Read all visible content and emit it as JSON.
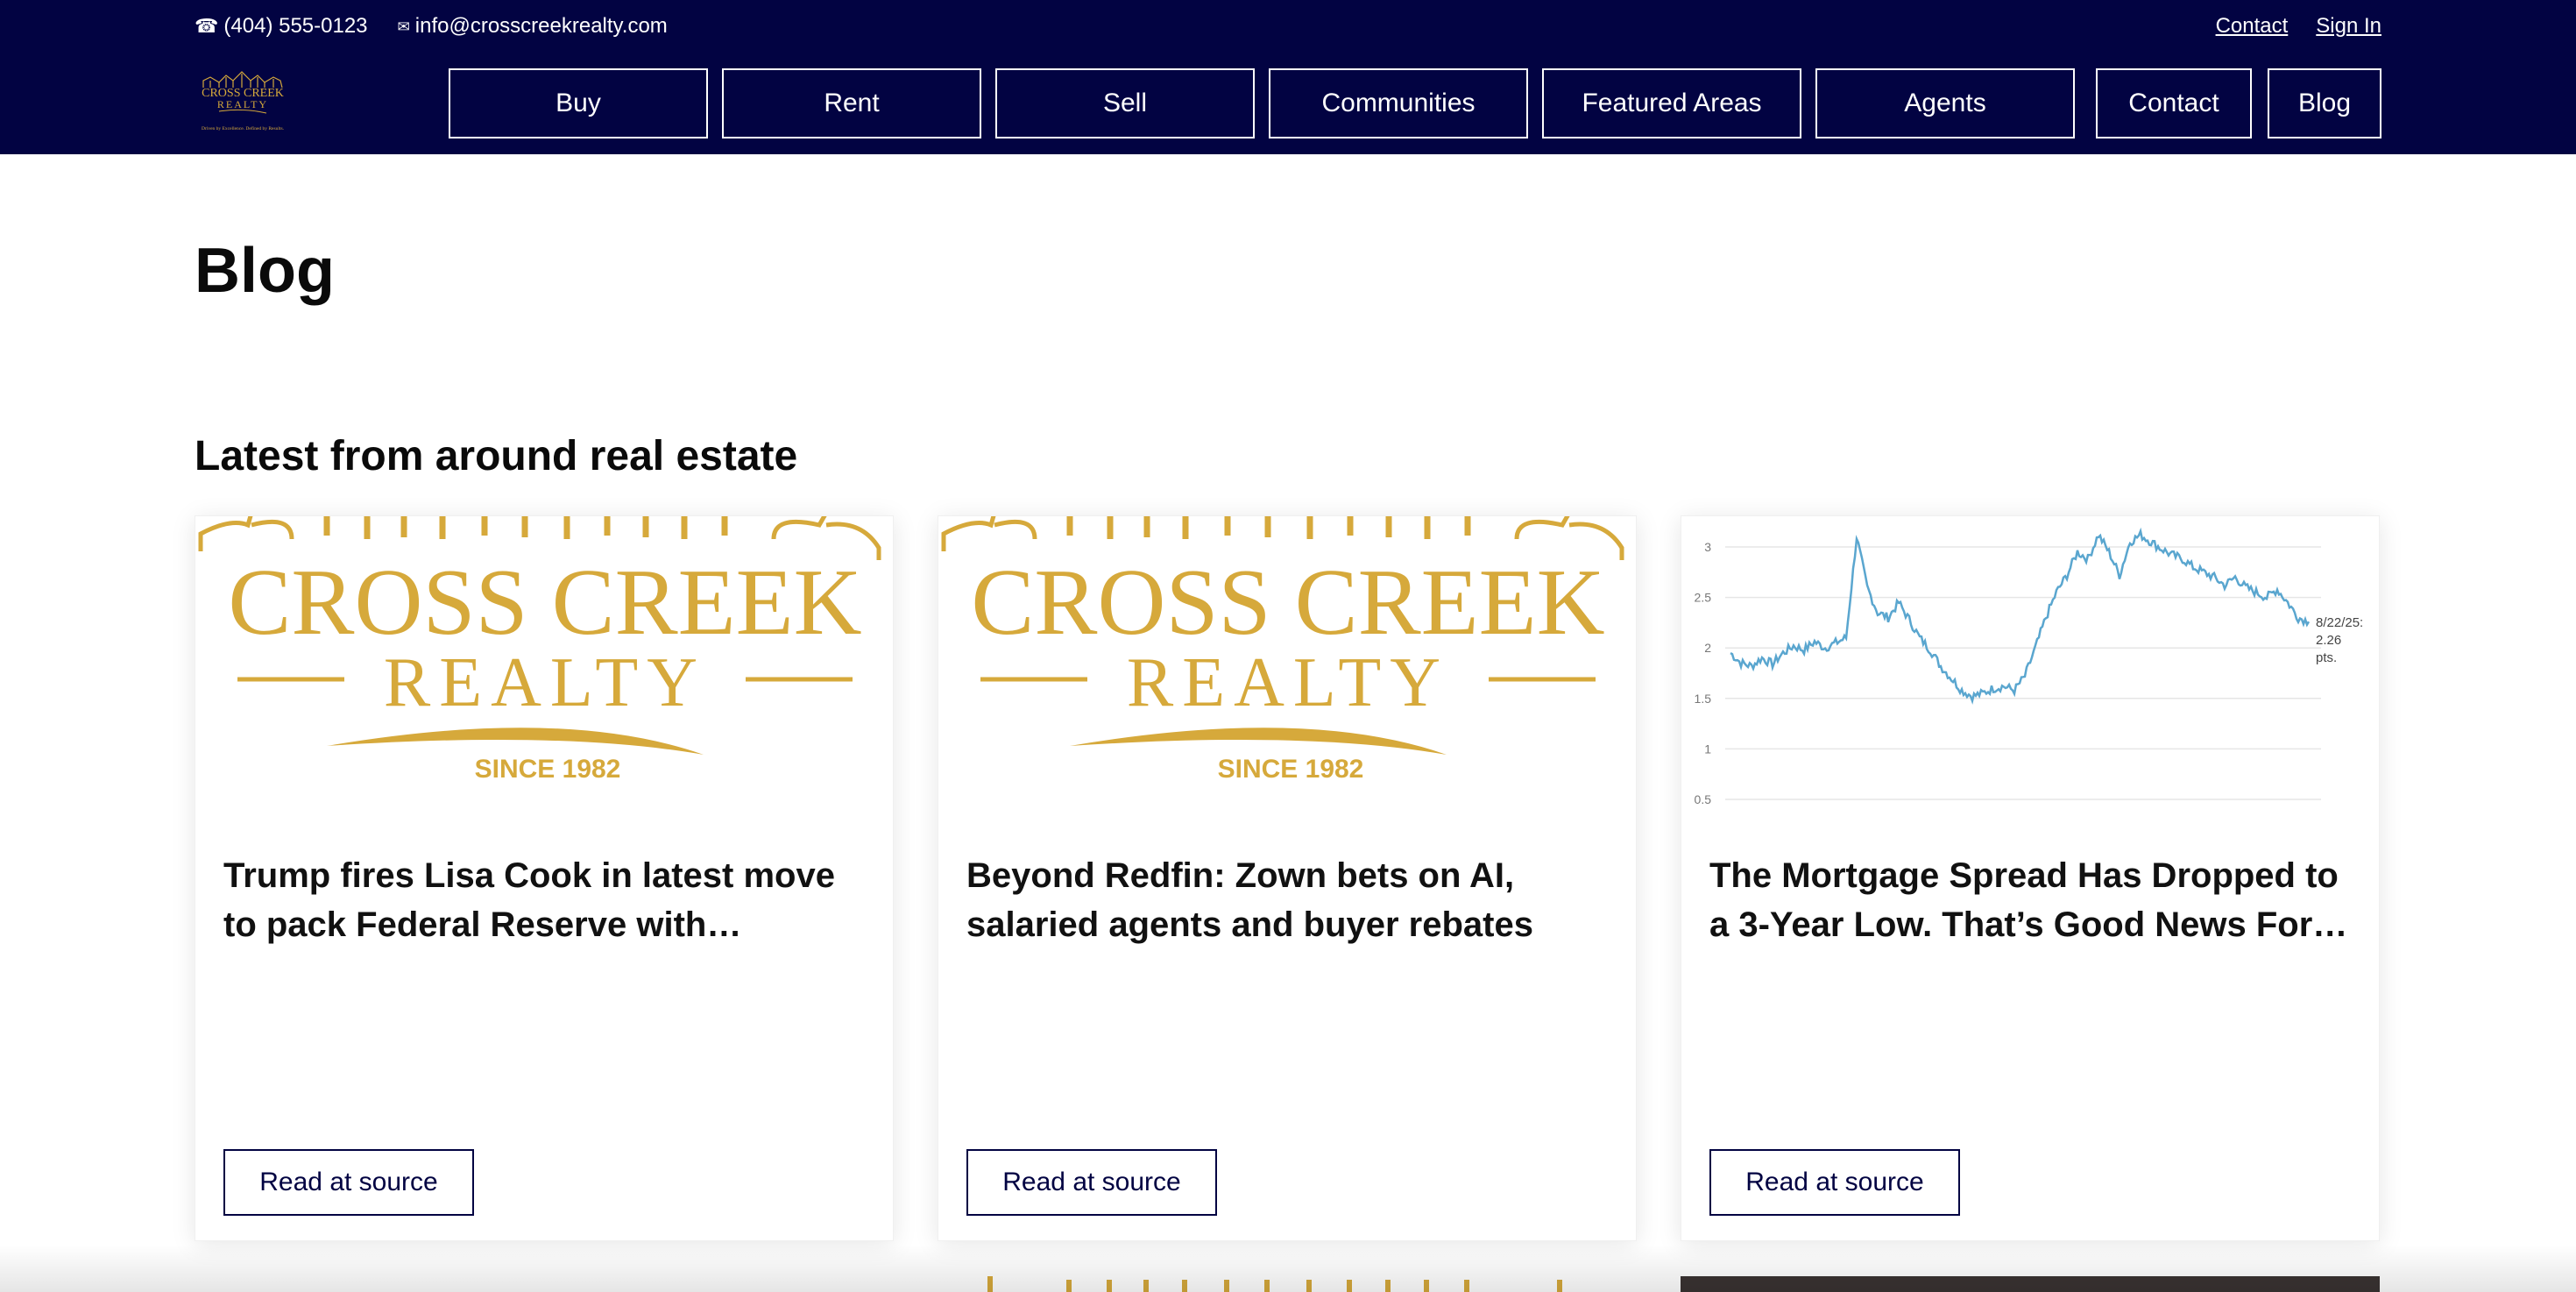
{
  "header": {
    "phone": "(404) 555-0123",
    "email": "info@crosscreekrealty.com",
    "links": [
      "Contact",
      "Sign In"
    ],
    "logo": {
      "line1": "CROSS CREEK",
      "line2": "REALTY",
      "tagline": "Driven by Excellence. Defined by Results."
    },
    "nav": [
      "Buy",
      "Rent",
      "Sell",
      "Communities",
      "Featured Areas",
      "Agents",
      "Contact",
      "Blog"
    ]
  },
  "page": {
    "title": "Blog",
    "section_title": "Latest from around real estate"
  },
  "brand_image": {
    "line1": "CROSS CREEK",
    "line2": "REALTY",
    "since": "SINCE 1982"
  },
  "cards": [
    {
      "headline": "Trump fires Lisa Cook in latest move to pack Federal Reserve with…",
      "cta": "Read at source",
      "image": "cross-creek-logo"
    },
    {
      "headline": "Beyond Redfin: Zown bets on AI, salaried agents and buyer rebates",
      "cta": "Read at source",
      "image": "cross-creek-logo"
    },
    {
      "headline": "The Mortgage Spread Has Dropped to a 3-Year Low. That’s Good News For…",
      "cta": "Read at source",
      "image": "mortgage-spread-chart"
    }
  ],
  "chart_data": {
    "type": "line",
    "yticks": [
      "3",
      "2.5",
      "2",
      "1.5",
      "1",
      "0.5"
    ],
    "ylim": [
      0.5,
      3.2
    ],
    "annotation": [
      "8/22/25:",
      "2.26",
      "pts."
    ],
    "series": [
      {
        "color": "#5aa6cf",
        "values": [
          1.95,
          1.85,
          1.82,
          1.9,
          1.84,
          1.95,
          2.02,
          1.98,
          2.06,
          2.0,
          2.05,
          2.1,
          3.1,
          2.6,
          2.35,
          2.3,
          2.45,
          2.28,
          2.1,
          1.98,
          1.82,
          1.7,
          1.58,
          1.52,
          1.55,
          1.6,
          1.62,
          1.58,
          1.72,
          2.0,
          2.3,
          2.55,
          2.72,
          2.95,
          2.88,
          3.12,
          2.95,
          2.72,
          3.05,
          3.12,
          3.05,
          2.98,
          2.92,
          2.88,
          2.8,
          2.75,
          2.7,
          2.62,
          2.7,
          2.6,
          2.55,
          2.5,
          2.58,
          2.45,
          2.3,
          2.26
        ]
      }
    ]
  },
  "colors": {
    "navy": "#020342",
    "gold": "#d6a93b",
    "chart_line": "#5aa6cf"
  }
}
